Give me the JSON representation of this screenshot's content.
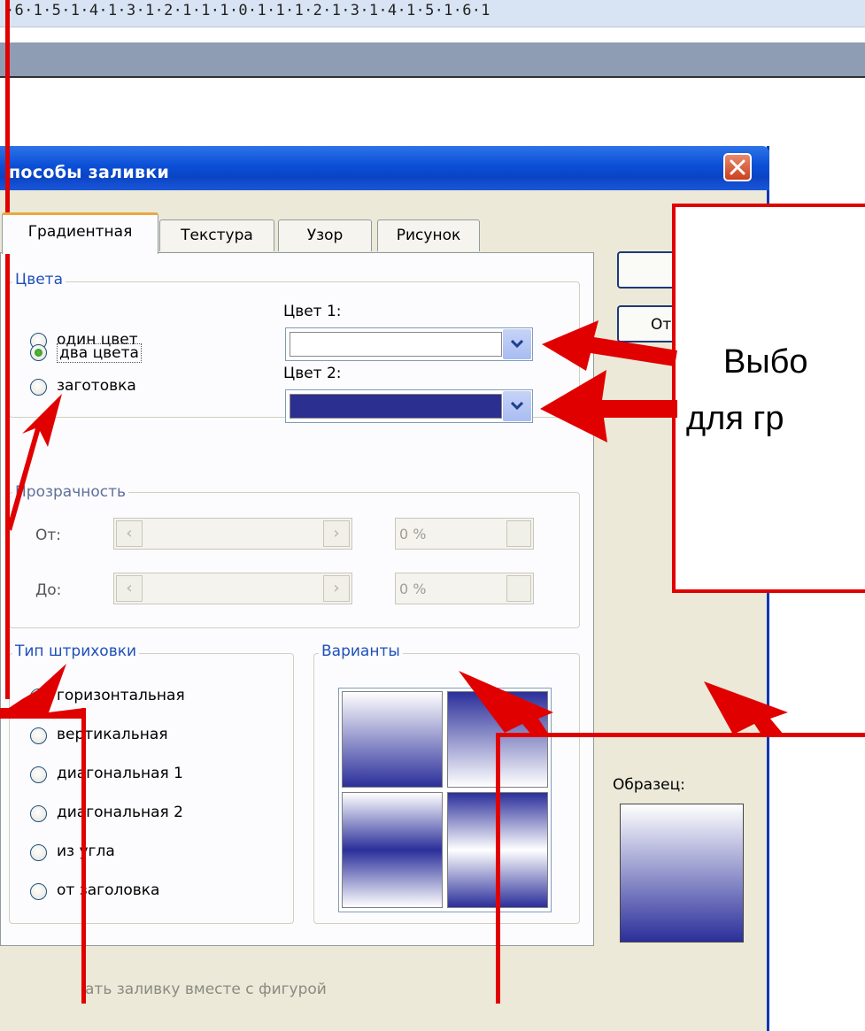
{
  "ruler": {
    "text": "·6·1·5·1·4·1·3·1·2·1·1·1·0·1·1·1·2·1·3·1·4·1·5·1·6·1"
  },
  "dialog": {
    "title": "пособы заливки",
    "tabs": [
      "Градиентная",
      "Текстура",
      "Узор",
      "Рисунок"
    ],
    "colors": {
      "legend": "Цвета",
      "options": [
        "один цвет",
        "два цвета",
        "заготовка"
      ],
      "selected_option": "два цвета",
      "color1_label": "Цвет 1:",
      "color1_value": "#ffffff",
      "color2_label": "Цвет 2:",
      "color2_value": "#2b2f8f"
    },
    "transparency": {
      "legend": "Прозрачность",
      "from_label": "От:",
      "to_label": "До:",
      "from_value": "0 %",
      "to_value": "0 %"
    },
    "shading": {
      "legend": "Тип штриховки",
      "options": [
        "горизонтальная",
        "вертикальная",
        "диагональная 1",
        "диагональная 2",
        "из угла",
        "от заголовка"
      ],
      "selected_option": "горизонтальная"
    },
    "variants": {
      "legend": "Варианты"
    },
    "sample_label": "Образец:",
    "ok_button_partial": "",
    "cancel_button_partial": "От",
    "rotate_checkbox_partial": "ать заливку вместе с фигурой"
  },
  "callout": {
    "line1": "Выбо",
    "line2": "для гр"
  },
  "colors": {
    "accent_red": "#e00000",
    "gradient_dark": "#2b2f9a",
    "title_blue": "#0a44c4"
  }
}
